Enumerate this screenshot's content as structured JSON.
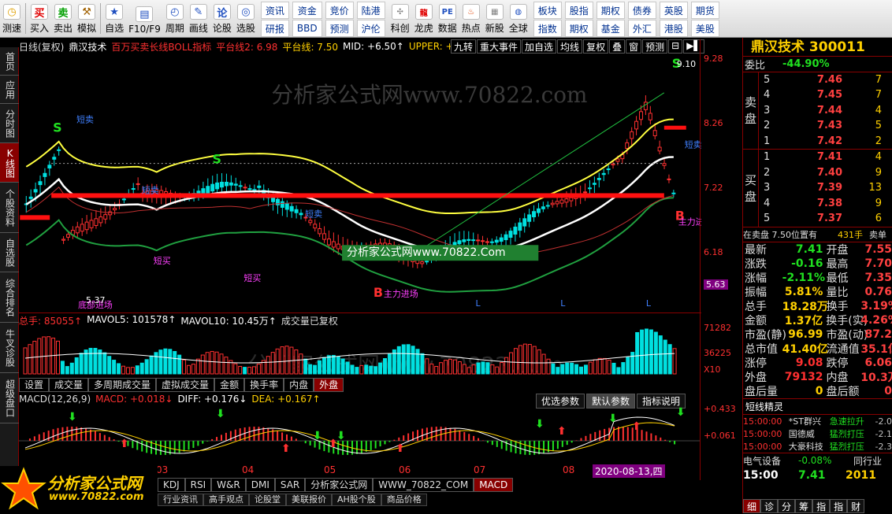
{
  "toolbar": {
    "buttons": [
      {
        "label": "测速",
        "icon": "clock-icon",
        "color": "#e0a000"
      },
      {
        "label": "买入",
        "icon": "buy-icon",
        "glyph": "买",
        "color": "#e00000"
      },
      {
        "label": "卖出",
        "icon": "sell-icon",
        "glyph": "卖",
        "color": "#00a000"
      },
      {
        "label": "模拟",
        "icon": "hammer-icon",
        "glyph": "⚒",
        "color": "#a06000"
      },
      {
        "label": "自选",
        "icon": "star-icon",
        "glyph": "★",
        "color": "#2050c0"
      },
      {
        "label": "F10/F9",
        "icon": "document-icon",
        "glyph": "▤",
        "color": "#2050c0"
      },
      {
        "label": "周期",
        "icon": "period-icon",
        "glyph": "◴",
        "color": "#2050c0"
      },
      {
        "label": "画线",
        "icon": "pencil-icon",
        "glyph": "✎",
        "color": "#2050c0"
      },
      {
        "label": "论股",
        "icon": "discuss-icon",
        "glyph": "论",
        "color": "#2050c0"
      },
      {
        "label": "选股",
        "icon": "screen-icon",
        "glyph": "◎",
        "color": "#2050c0"
      }
    ],
    "grid1": [
      "资讯",
      "研报",
      "资金",
      "BBD",
      "竞价",
      "预测",
      "陆港",
      "沪伦"
    ],
    "buttons2": [
      {
        "label": "科创",
        "icon": "science-icon",
        "glyph": "✣",
        "color": "#808080"
      },
      {
        "label": "龙虎",
        "icon": "dragon-icon",
        "glyph": "龍",
        "color": "#e00000"
      },
      {
        "label": "数据",
        "icon": "pe-icon",
        "glyph": "PE",
        "color": "#2050c0"
      },
      {
        "label": "热点",
        "icon": "hot-icon",
        "glyph": "♨",
        "color": "#e04000"
      },
      {
        "label": "新股",
        "icon": "newstock-icon",
        "glyph": "▦",
        "color": "#808080"
      },
      {
        "label": "全球",
        "icon": "globe-icon",
        "glyph": "◍",
        "color": "#2050c0"
      }
    ],
    "grid2": [
      "板块",
      "指数",
      "股指",
      "期权",
      "期权",
      "基金",
      "债券",
      "外汇",
      "英股",
      "港股",
      "期货",
      "美股"
    ]
  },
  "lefttabs": [
    "首页",
    "应用",
    "分时图",
    "K线图",
    "个股资料",
    "自选股",
    "综合排名",
    "牛叉诊股",
    "超级盘口"
  ],
  "chart": {
    "header": [
      {
        "t": "日线(复权)",
        "c": "#ddd"
      },
      {
        "t": "鼎汉技术",
        "c": "#fff"
      },
      {
        "t": "百万买卖长线BOLL指标",
        "c": "#ff3030"
      },
      {
        "t": "平台线2: 6.98",
        "c": "#ff3030"
      },
      {
        "t": "平台线: 7.50",
        "c": "#ffd000"
      },
      {
        "t": "MID: +6.50↑",
        "c": "#fff"
      },
      {
        "t": "UPPER: +",
        "c": "#ffd000"
      }
    ],
    "menu": [
      "九转",
      "重大事件",
      "加自选",
      "均线",
      "复权",
      "叠",
      "窗",
      "预测",
      "⊟",
      "▶▌"
    ],
    "watermark": "分析家公式网www.70822.com",
    "watermark2": "分析家公式网www.70822.Com",
    "y_ticks": [
      "9.28",
      "8.26",
      "7.22",
      "6.18",
      "5.63"
    ],
    "high_label": "9.10",
    "low_label": "5.37",
    "annotations": [
      "短卖",
      "短卖",
      "短买",
      "短买",
      "短买",
      "短买",
      "短卖",
      "短卖",
      "主力进场",
      "主力进场",
      "底部进场",
      "S",
      "S",
      "S",
      "B",
      "B",
      "L",
      "L",
      "L",
      "L"
    ],
    "ticks_extra": "底部进场"
  },
  "volume": {
    "header": [
      {
        "t": "总手: 85055↑",
        "c": "#ff3030"
      },
      {
        "t": "MAVOL5: 101578↑",
        "c": "#fff"
      },
      {
        "t": "MAVOL10: 10.45万↑",
        "c": "#fff"
      },
      {
        "t": "成交量已复权",
        "c": "#ddd"
      }
    ],
    "y_ticks": [
      "71282",
      "36225",
      "X10"
    ],
    "watermark": "分析家公式网www.70822.com"
  },
  "tabs1": [
    "设置",
    "成交量",
    "多周期成交量",
    "虚拟成交量",
    "金额",
    "换手率",
    "内盘",
    "外盘"
  ],
  "macd": {
    "header": [
      {
        "t": "MACD(12,26,9)",
        "c": "#ddd"
      },
      {
        "t": "MACD: +0.018↓",
        "c": "#ff3030"
      },
      {
        "t": "DIFF: +0.176↓",
        "c": "#fff"
      },
      {
        "t": "DEA: +0.167↑",
        "c": "#ffd000"
      }
    ],
    "buttons": [
      "优选参数",
      "默认参数",
      "指标说明"
    ],
    "y_ticks": [
      "+0.433",
      "+0.061"
    ]
  },
  "xlabels": [
    "03",
    "04",
    "05",
    "06",
    "07",
    "08"
  ],
  "date_label": "2020-08-13,四",
  "tabs2": [
    "KDJ",
    "RSI",
    "W&R",
    "DMI",
    "SAR",
    "分析家公式网",
    "WWW_70822_COM",
    "MACD"
  ],
  "tabs3": [
    "行业资讯",
    "高手观点",
    "论股堂",
    "美联报价",
    "AH股个股",
    "商品价格"
  ],
  "logo": {
    "title": "分析家公式网",
    "url": "www.70822.com"
  },
  "quote": {
    "title": "鼎汉技术 300011",
    "webi": {
      "label": "委比",
      "value": "-44.90%"
    },
    "sell_side": "卖盘",
    "buy_side": "买盘",
    "asks": [
      [
        "5",
        "7.46",
        "7"
      ],
      [
        "4",
        "7.45",
        "7"
      ],
      [
        "3",
        "7.44",
        "4"
      ],
      [
        "2",
        "7.43",
        "5"
      ],
      [
        "1",
        "7.42",
        "2"
      ]
    ],
    "bids": [
      [
        "1",
        "7.41",
        "4"
      ],
      [
        "2",
        "7.40",
        "9"
      ],
      [
        "3",
        "7.39",
        "13"
      ],
      [
        "4",
        "7.38",
        "9"
      ],
      [
        "5",
        "7.37",
        "6"
      ]
    ],
    "sellpos": {
      "t": "在卖盘 7.50位置有",
      "v": "431手",
      "s": "卖单"
    },
    "stats": [
      [
        "最新",
        "7.41",
        "开盘",
        "7.55"
      ],
      [
        "涨跌",
        "-0.16",
        "最高",
        "7.70"
      ],
      [
        "涨幅",
        "-2.11%",
        "最低",
        "7.35"
      ],
      [
        "振幅",
        "5.81%",
        "量比",
        "0.76"
      ],
      [
        "总手",
        "18.28万",
        "换手",
        "3.19%"
      ],
      [
        "金额",
        "1.37亿",
        "换手(实)",
        "4.26%"
      ],
      [
        "市盈(静)",
        "96.99",
        "市盈(动)",
        "87.2"
      ],
      [
        "总市值",
        "41.40亿",
        "流通值",
        "35.1亿"
      ],
      [
        "涨停",
        "9.08",
        "跌停",
        "6.06"
      ],
      [
        "外盘",
        "79132",
        "内盘",
        "10.3万"
      ],
      [
        "盘后量",
        "0",
        "盘后额",
        "0"
      ]
    ],
    "news_title": "短线精灵",
    "news": [
      [
        "15:00:00",
        "*ST群兴",
        "急速拉升",
        "-2.0"
      ],
      [
        "15:00:00",
        "国德威",
        "猛烈打压",
        "-2.1"
      ],
      [
        "15:00:00",
        "大豪科技",
        "猛烈打压",
        "-2.3"
      ]
    ],
    "sector": {
      "name": "电气设备",
      "pct": "-0.08%",
      "extra": "同行业"
    },
    "last": {
      "time": "15:00",
      "price": "7.41",
      "vol": "2011"
    },
    "bottom_tabs": [
      "细",
      "诊",
      "分",
      "筹",
      "指",
      "指",
      "财"
    ]
  },
  "colors": {
    "up": "#ff3030",
    "down": "#20e020",
    "accent": "#800000",
    "yellow": "#ffd000"
  }
}
